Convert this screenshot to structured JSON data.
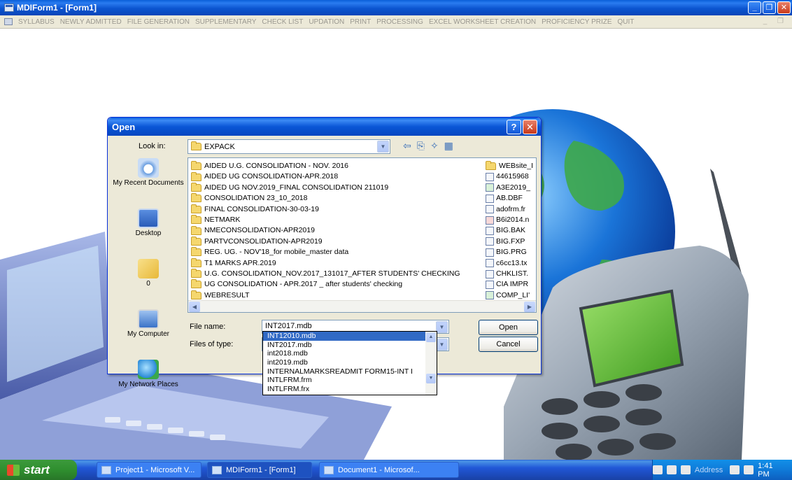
{
  "window": {
    "title": "MDIForm1 - [Form1]",
    "minimize": "_",
    "maximize": "❐",
    "close": "✕"
  },
  "menu": {
    "items": [
      "SYLLABUS",
      "NEWLY ADMITTED",
      "FILE GENERATION",
      "SUPPLEMENTARY",
      "CHECK LIST",
      "UPDATION",
      "PRINT",
      "PROCESSING",
      "EXCEL WORKSHEET CREATION",
      "PROFICIENCY PRIZE",
      "QUIT"
    ],
    "child_controls": "_ ❐"
  },
  "dialog": {
    "title": "Open",
    "help": "?",
    "close": "✕",
    "look_in_label": "Look in:",
    "look_in_value": "EXPACK",
    "places": [
      {
        "label": "My Recent Documents",
        "icon": "recent-documents-icon"
      },
      {
        "label": "Desktop",
        "icon": "desktop-icon"
      },
      {
        "label": "0",
        "icon": "folder-open-icon"
      },
      {
        "label": "My Computer",
        "icon": "my-computer-icon"
      },
      {
        "label": "My Network Places",
        "icon": "network-places-icon"
      }
    ],
    "folders": [
      "AIDED U.G. CONSOLIDATION - NOV. 2016",
      "AIDED UG CONSOLIDATION-APR.2018",
      "AIDED UG NOV.2019_FINAL CONSOLIDATION 211019",
      "CONSOLIDATION 23_10_2018",
      "FINAL CONSOLIDATION-30-03-19",
      "NETMARK",
      "NMECONSOLIDATION-APR2019",
      "PARTVCONSOLIDATION-APR2019",
      "REG. UG. - NOV'18_for mobile_master data",
      "T1 MARKS APR.2019",
      "U.G. CONSOLIDATION_NOV.2017_131017_AFTER STUDENTS' CHECKING",
      "UG CONSOLIDATION - APR.2017 _ after students' checking",
      "WEBRESULT"
    ],
    "files": [
      "WEBsite_I",
      "44615968",
      "A3E2019_",
      "AB.DBF",
      "adofrm.fr",
      "B6i2014.n",
      "BIG.BAK",
      "BIG.FXP",
      "BIG.PRG",
      "c6cc13.tx",
      "CHKLIST.",
      "CIA IMPR",
      "COMP_LI'"
    ],
    "file_name_label": "File name:",
    "file_name_value": "INT2017.mdb",
    "file_type_label": "Files of type:",
    "open_button": "Open",
    "cancel_button": "Cancel",
    "dropdown_items": [
      "INT12010.mdb",
      "INT2017.mdb",
      "int2018.mdb",
      "int2019.mdb",
      "INTERNALMARKSREADMIT FORM15-INT I",
      "INTLFRM.frm",
      "INTLFRM.frx"
    ],
    "dropdown_selected_index": 0
  },
  "taskbar": {
    "start": "start",
    "tasks": [
      "Project1 - Microsoft V...",
      "MDIForm1 - [Form1]",
      "Document1 - Microsof..."
    ],
    "address_label": "Address",
    "clock": "1:41 PM"
  },
  "colors": {
    "xp_blue": "#0a56d6",
    "dialog_face": "#ece9d8",
    "selection": "#316ac5",
    "start_green": "#2f8f2f"
  }
}
